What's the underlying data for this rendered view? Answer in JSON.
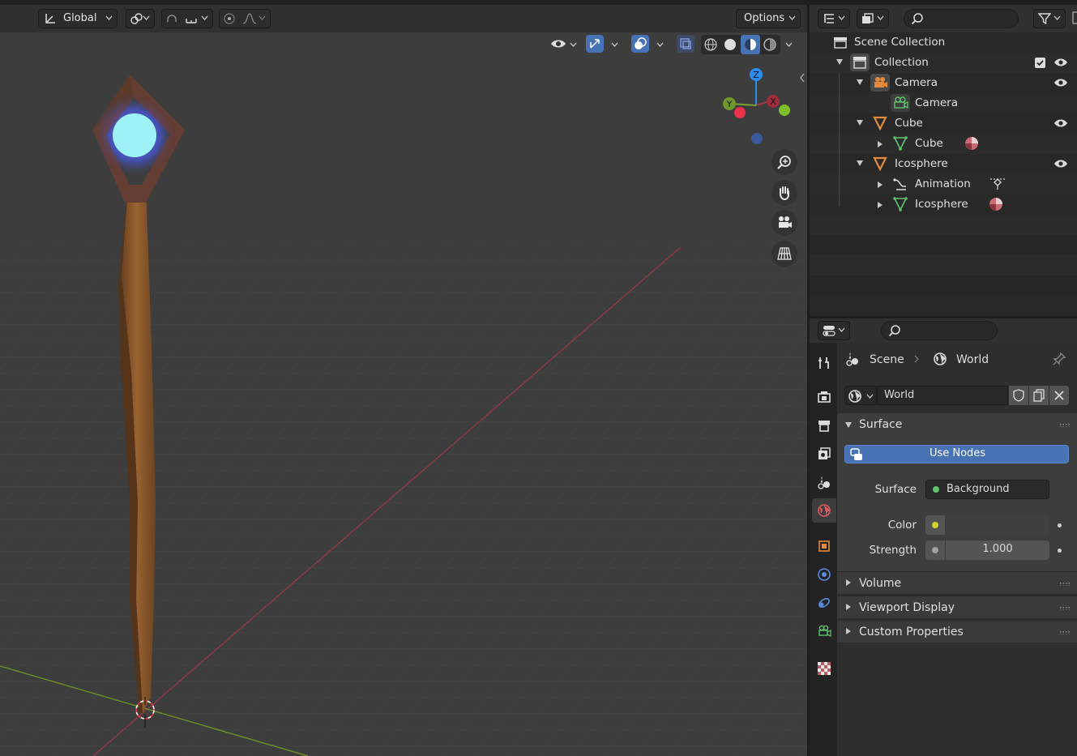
{
  "viewport_header": {
    "transform_orientation": "Global",
    "options_label": "Options"
  },
  "gizmo": {
    "z": "Z",
    "y": "Y",
    "x": "X"
  },
  "outliner": {
    "search_placeholder": "",
    "rows": [
      {
        "label": "Scene Collection"
      },
      {
        "label": "Collection"
      },
      {
        "label": "Camera"
      },
      {
        "label": "Camera"
      },
      {
        "label": "Cube"
      },
      {
        "label": "Cube"
      },
      {
        "label": "Icosphere"
      },
      {
        "label": "Animation"
      },
      {
        "label": "Icosphere"
      }
    ]
  },
  "properties": {
    "search_placeholder": "",
    "breadcrumb": {
      "scene": "Scene",
      "world": "World"
    },
    "world_name": "World",
    "surface_panel": "Surface",
    "use_nodes_label": "Use Nodes",
    "surface_label": "Surface",
    "surface_value": "Background",
    "color_label": "Color",
    "strength_label": "Strength",
    "strength_value": "1.000",
    "panels": [
      "Volume",
      "Viewport Display",
      "Custom Properties"
    ]
  },
  "colors": {
    "accent_blue": "#4772b3",
    "x_axis": "#a33a47",
    "y_axis": "#7aa22f",
    "z_axis": "#2d8cf0",
    "object_orange": "#e38b3a",
    "mesh_green": "#5ec46d",
    "orb_glow": "#9ff3f7"
  }
}
